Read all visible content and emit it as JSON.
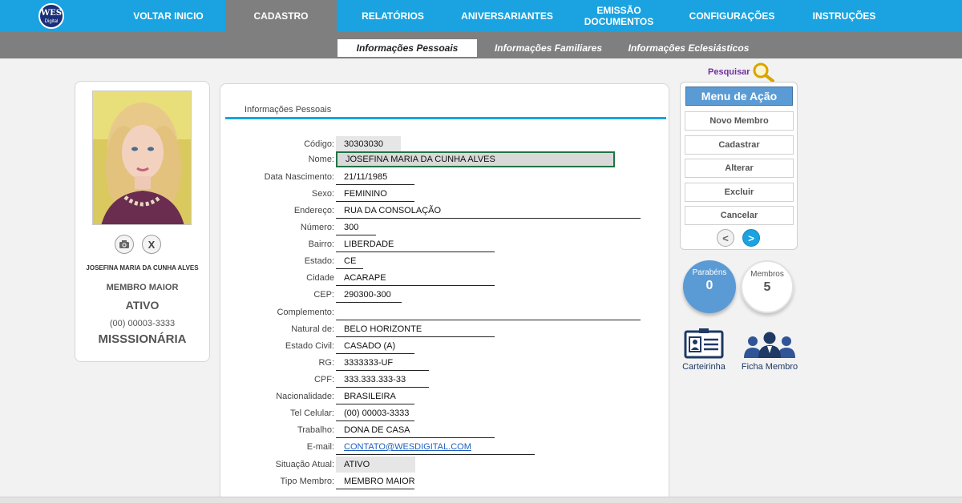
{
  "nav": {
    "items": [
      {
        "label": "VOLTAR INICIO"
      },
      {
        "label": "CADASTRO"
      },
      {
        "label": "RELATÓRIOS"
      },
      {
        "label": "ANIVERSARIANTES"
      },
      {
        "label": "EMISSÃO DOCUMENTOS"
      },
      {
        "label": "CONFIGURAÇÕES"
      },
      {
        "label": "INSTRUÇÕES"
      }
    ],
    "logo_text": "WES",
    "logo_sub": "Digital"
  },
  "subnav": {
    "tabs": [
      {
        "label": "Informações Pessoais"
      },
      {
        "label": "Informações Familiares"
      },
      {
        "label": "Informações Eclesiásticos"
      }
    ]
  },
  "profile": {
    "name": "JOSEFINA MARIA DA CUNHA ALVES",
    "type": "MEMBRO MAIOR",
    "status": "ATIVO",
    "phone": "(00) 00003-3333",
    "role": "MISSSIONÁRIA",
    "clear_glyph": "X"
  },
  "form": {
    "title": "Informações Pessoais",
    "fields": [
      {
        "label": "Código:",
        "value": "30303030"
      },
      {
        "label": "Nome:",
        "value": "JOSEFINA MARIA DA CUNHA ALVES"
      },
      {
        "label": "Data Nascimento:",
        "value": "21/11/1985"
      },
      {
        "label": "Sexo:",
        "value": "FEMININO"
      },
      {
        "label": "Endereço:",
        "value": "RUA DA CONSOLAÇÃO"
      },
      {
        "label": "Número:",
        "value": "300"
      },
      {
        "label": "Bairro:",
        "value": "LIBERDADE"
      },
      {
        "label": "Estado:",
        "value": "CE"
      },
      {
        "label": "Cidade",
        "value": "ACARAPE"
      },
      {
        "label": "CEP:",
        "value": "290300-300"
      },
      {
        "label": "Complemento:",
        "value": ""
      },
      {
        "label": "Natural de:",
        "value": "BELO HORIZONTE"
      },
      {
        "label": "Estado Civil:",
        "value": "CASADO (A)"
      },
      {
        "label": "RG:",
        "value": "3333333-UF"
      },
      {
        "label": "CPF:",
        "value": "333.333.333-33"
      },
      {
        "label": "Nacionalidade:",
        "value": "BRASILEIRA"
      },
      {
        "label": "Tel Celular:",
        "value": "(00) 00003-3333"
      },
      {
        "label": "Trabalho:",
        "value": "DONA DE CASA"
      },
      {
        "label": "E-mail:",
        "value": "CONTATO@WESDIGITAL.COM"
      },
      {
        "label": "Situação Atual:",
        "value": "ATIVO"
      },
      {
        "label": "Tipo Membro:",
        "value": "MEMBRO MAIOR"
      }
    ]
  },
  "search": {
    "label": "Pesquisar"
  },
  "actions": {
    "title": "Menu de Ação",
    "buttons": [
      {
        "label": "Novo Membro"
      },
      {
        "label": "Cadastrar"
      },
      {
        "label": "Alterar"
      },
      {
        "label": "Excluir"
      },
      {
        "label": "Cancelar"
      }
    ],
    "prev_glyph": "<",
    "next_glyph": ">"
  },
  "stats": {
    "parabens_label": "Parabéns",
    "parabens_value": "0",
    "membros_label": "Membros",
    "membros_value": "5"
  },
  "tools": {
    "carteirinha": "Carteirinha",
    "ficha": "Ficha Membro"
  },
  "colors": {
    "nav_blue": "#1aa3e0",
    "nav_active_gray": "#7f7f7f",
    "action_title_blue": "#5b9bd5",
    "stat_blue": "#5b9bd5",
    "search_purple": "#7030a0",
    "selection_green": "#217346"
  }
}
